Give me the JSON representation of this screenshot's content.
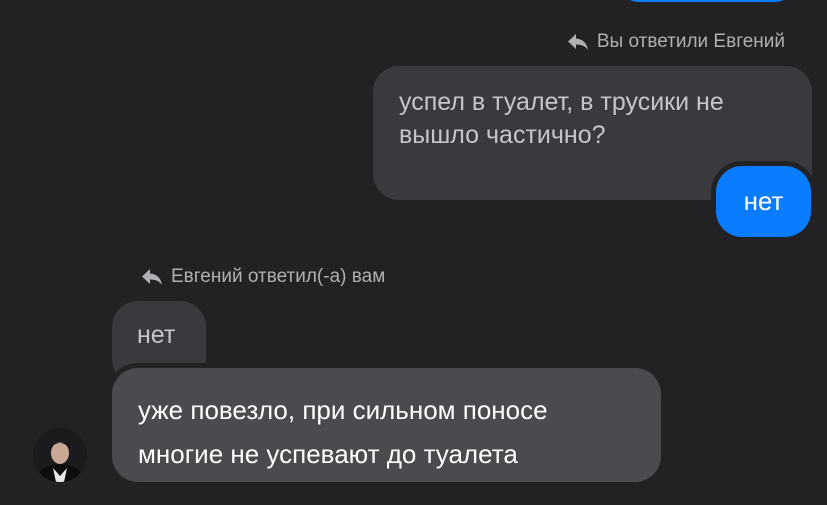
{
  "chat": {
    "sent_reply": {
      "label": "Вы ответили Евгений",
      "icon": "reply-icon",
      "quoted_text_line1": "успел в туалет, в трусики не",
      "quoted_text_line2": "вышло частично?",
      "message": "нет"
    },
    "received_reply": {
      "label": "Евгений ответил(-а) вам",
      "icon": "reply-icon",
      "quoted_text": "нет",
      "message_line1": "уже повезло, при сильном поносе",
      "message_line2": "многие не успевают до туалета"
    },
    "avatar": {
      "icon": "contact-avatar"
    }
  },
  "colors": {
    "background": "#222225",
    "sent_bubble": "#0a7cff",
    "received_bubble": "#4a4a4f",
    "quoted_bubble": "#3a3a3e",
    "label_text": "#b0b0b4"
  }
}
